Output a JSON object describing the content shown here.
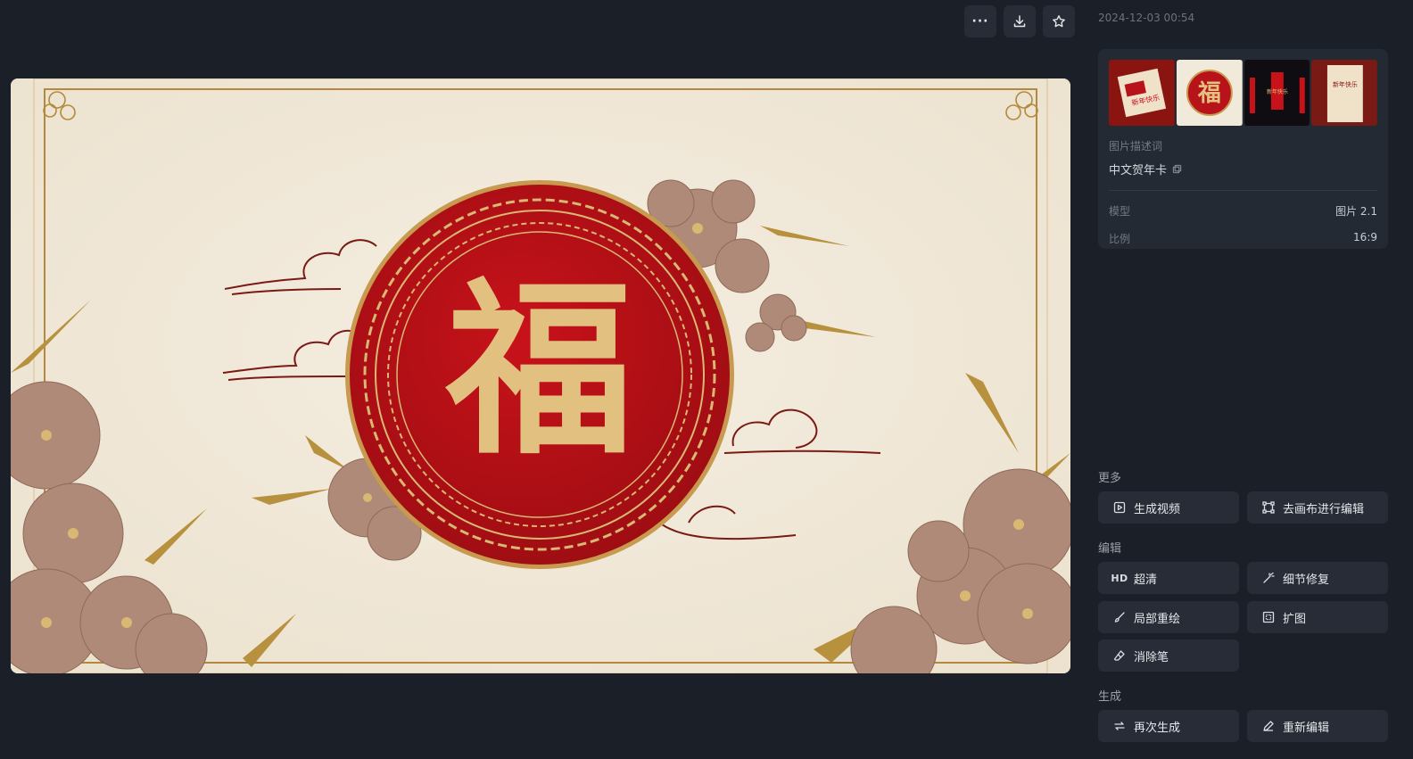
{
  "header": {
    "timestamp": "2024-12-03 00:54"
  },
  "image": {
    "main_character": "福"
  },
  "info_panel": {
    "thumbnails": [
      {
        "text": "新年快乐"
      },
      {
        "text": "福"
      },
      {
        "text": "新年快乐"
      },
      {
        "text": "新年快乐"
      }
    ],
    "description_label": "图片描述词",
    "description_value": "中文贺年卡",
    "meta": [
      {
        "key": "模型",
        "value": "图片 2.1"
      },
      {
        "key": "比例",
        "value": "16:9"
      }
    ]
  },
  "sections": {
    "more": {
      "title": "更多",
      "generate_video": "生成视频",
      "canvas_edit": "去画布进行编辑"
    },
    "edit": {
      "title": "编辑",
      "hd_badge": "HD",
      "upscale": "超清",
      "detail_fix": "细节修复",
      "inpaint": "局部重绘",
      "expand": "扩图",
      "eraser": "消除笔"
    },
    "generate": {
      "title": "生成",
      "regenerate": "再次生成",
      "reedit": "重新编辑"
    }
  }
}
